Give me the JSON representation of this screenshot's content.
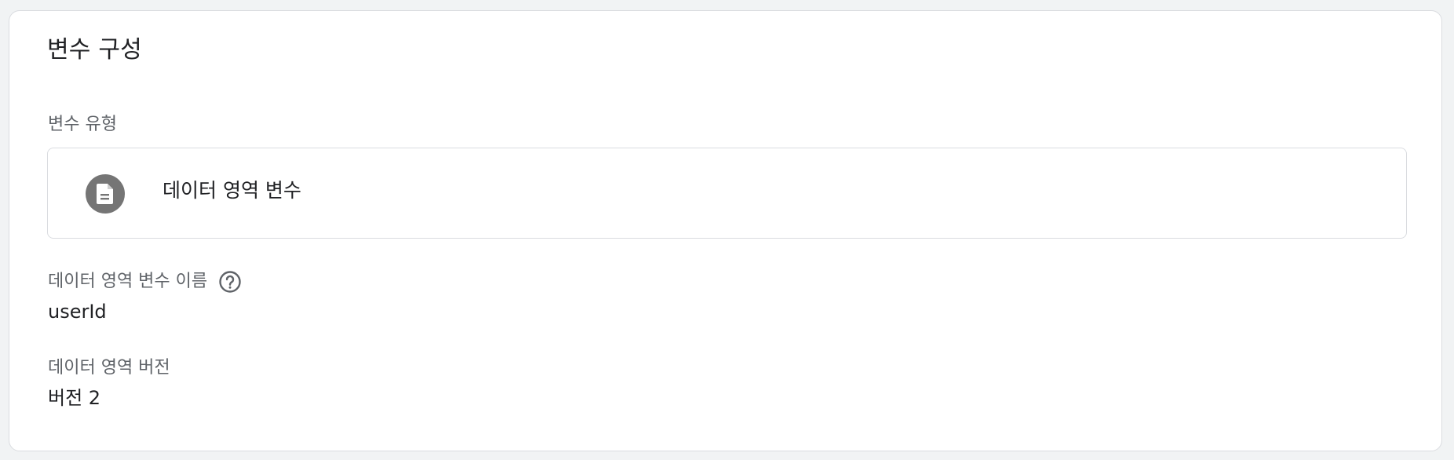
{
  "card": {
    "title": "변수 구성"
  },
  "variable_type": {
    "label": "변수 유형",
    "selected": "데이터 영역 변수",
    "icon": "document-icon"
  },
  "data_layer_variable_name": {
    "label": "데이터 영역 변수 이름",
    "value": "userId",
    "help_icon": "help-icon"
  },
  "data_layer_version": {
    "label": "데이터 영역 버전",
    "value": "버전 2"
  },
  "colors": {
    "background": "#f1f3f4",
    "card": "#ffffff",
    "border": "#dadce0",
    "label_text": "#5f6368",
    "primary_text": "#202124",
    "icon_circle": "#757575"
  }
}
